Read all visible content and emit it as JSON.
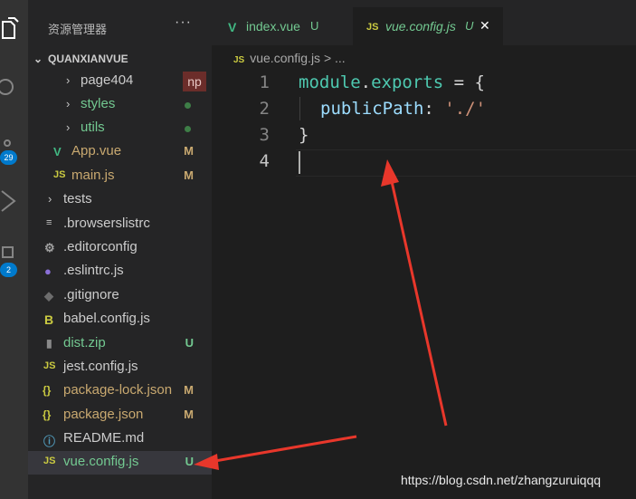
{
  "activity_bar": {
    "source_control_badge": "29",
    "extensions_badge": "2"
  },
  "explorer": {
    "title": "资源管理器",
    "more": "···",
    "section": "QUANXIANVUE",
    "items": [
      {
        "label": "page404",
        "status": "np"
      },
      {
        "label": "styles",
        "status": "dot"
      },
      {
        "label": "utils",
        "status": "dot"
      },
      {
        "label": "App.vue",
        "status": "M"
      },
      {
        "label": "main.js",
        "status": "M"
      },
      {
        "label": "tests",
        "status": ""
      },
      {
        "label": ".browserslistrc",
        "status": ""
      },
      {
        "label": ".editorconfig",
        "status": ""
      },
      {
        "label": ".eslintrc.js",
        "status": ""
      },
      {
        "label": ".gitignore",
        "status": ""
      },
      {
        "label": "babel.config.js",
        "status": ""
      },
      {
        "label": "dist.zip",
        "status": "U"
      },
      {
        "label": "jest.config.js",
        "status": ""
      },
      {
        "label": "package-lock.json",
        "status": "M"
      },
      {
        "label": "package.json",
        "status": "M"
      },
      {
        "label": "README.md",
        "status": ""
      },
      {
        "label": "vue.config.js",
        "status": "U"
      }
    ]
  },
  "tabs": [
    {
      "label": "index.vue",
      "status": "U",
      "icon": "vue-icon"
    },
    {
      "label": "vue.config.js",
      "status": "U",
      "icon": "js-icon",
      "close": "✕"
    }
  ],
  "breadcrumb": {
    "file": "vue.config.js",
    "sep": " > ...",
    "icon_text": "JS"
  },
  "editor": {
    "line_numbers": [
      "1",
      "2",
      "3",
      "4"
    ],
    "code": {
      "l1_obj": "module",
      "l1_dot": ".",
      "l1_prop": "exports",
      "l1_rest": " = {",
      "l2_key": "publicPath",
      "l2_colon": ": ",
      "l2_val": "'./'",
      "l3": "}"
    }
  },
  "watermark": "https://blog.csdn.net/zhangzuruiqqq",
  "colors": {
    "accent": "#007acc",
    "untracked": "#73c991",
    "modified": "#c9a970",
    "annotation_arrow": "#e8372b"
  }
}
